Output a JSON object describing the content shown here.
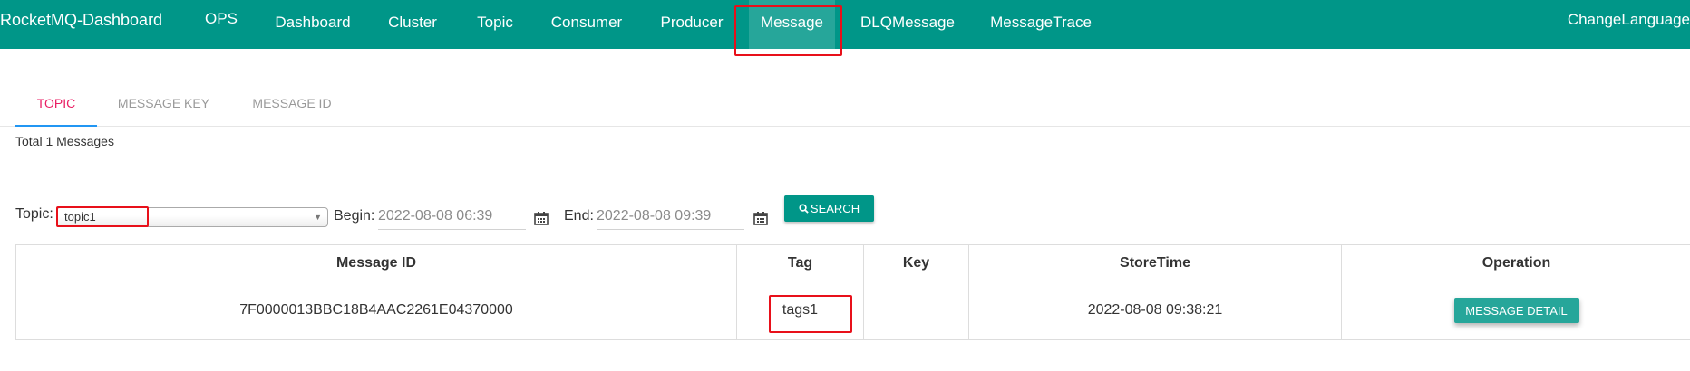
{
  "navbar": {
    "brand": "RocketMQ-Dashboard",
    "items": [
      {
        "label": "OPS"
      },
      {
        "label": "Dashboard"
      },
      {
        "label": "Cluster"
      },
      {
        "label": "Topic"
      },
      {
        "label": "Consumer"
      },
      {
        "label": "Producer"
      },
      {
        "label": "Message",
        "active": true
      },
      {
        "label": "DLQMessage"
      },
      {
        "label": "MessageTrace"
      }
    ],
    "change_language": "ChangeLanguage"
  },
  "tabs": [
    {
      "label": "TOPIC",
      "active": true
    },
    {
      "label": "MESSAGE KEY"
    },
    {
      "label": "MESSAGE ID"
    }
  ],
  "total_label": "Total 1 Messages",
  "filter": {
    "topic_label": "Topic:",
    "topic_value": "topic1",
    "begin_label": "Begin:",
    "begin_value": "2022-08-08 06:39",
    "end_label": "End:",
    "end_value": "2022-08-08 09:39",
    "search_label": "SEARCH"
  },
  "table": {
    "headers": [
      "Message ID",
      "Tag",
      "Key",
      "StoreTime",
      "Operation"
    ],
    "rows": [
      {
        "message_id": "7F0000013BBC18B4AAC2261E04370000",
        "tag": "tags1",
        "key": "",
        "store_time": "2022-08-08 09:38:21",
        "operation": "MESSAGE DETAIL"
      }
    ]
  },
  "colors": {
    "navbar": "#009688",
    "active_tab_text": "#e91e63",
    "active_tab_underline": "#2196f3",
    "annotation_box": "#e8101a"
  },
  "icons": [
    "calendar-icon",
    "search-icon",
    "chevron-down-icon"
  ]
}
